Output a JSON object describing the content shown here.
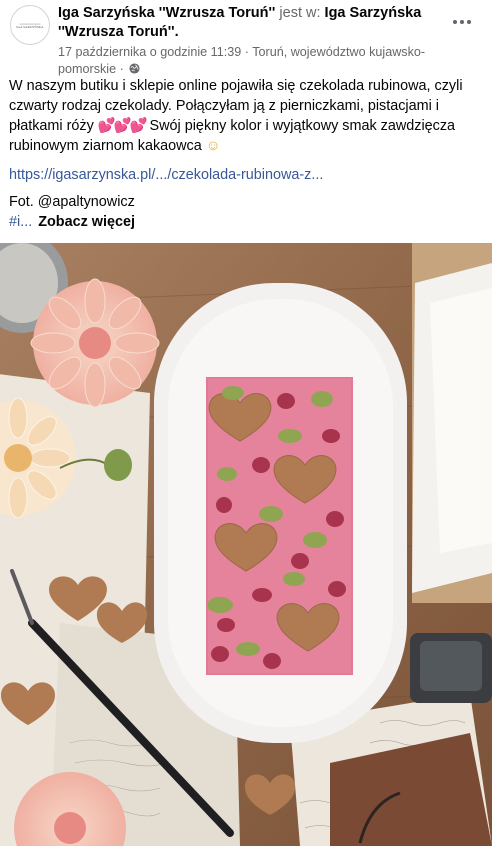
{
  "post": {
    "author": "Iga Sarzyńska ''Wzrusza Toruń''",
    "connector": "jest w:",
    "location_page": "Iga Sarzyńska ''Wzrusza Toruń''.",
    "timestamp": "17 października o godzinie 11:39",
    "separator": "·",
    "place": "Toruń, województwo kujawsko-pomorskie",
    "privacy_icon": "globe-icon",
    "more_icon": "more-options-icon",
    "avatar_text": "IGA SARZYŃSKA"
  },
  "content": {
    "text": "W naszym butiku i sklepie online pojawiła się  czekolada rubinowa, czyli czwarty rodzaj czekolady. Połączyłam ją z pierniczkami, pistacjami i płatkami róży",
    "emoji_hearts": "💕💕💕",
    "text_after": " Swój piękny kolor i wyjątkowy smak zawdzięcza rubinowym ziarnom kakaowca",
    "emoji_smile": "☺",
    "link": "https://igasarzynska.pl/.../czekolada-rubinowa-z...",
    "credit": "Fot. @apaltynowicz",
    "hashtag_truncated": "#i...",
    "see_more": "Zobacz więcej"
  },
  "photo": {
    "alt": "photo-ruby-chocolate-bar",
    "colors": {
      "table": "#9c7456",
      "plate": "#f2f1ef",
      "chocolate": "#e07a95",
      "cookie": "#b07a52",
      "pistachio": "#8fa552",
      "petal": "#a8334d",
      "dahlia": "#f3bcaa",
      "paper": "#ebe6de",
      "leather": "#7a4a35"
    }
  }
}
